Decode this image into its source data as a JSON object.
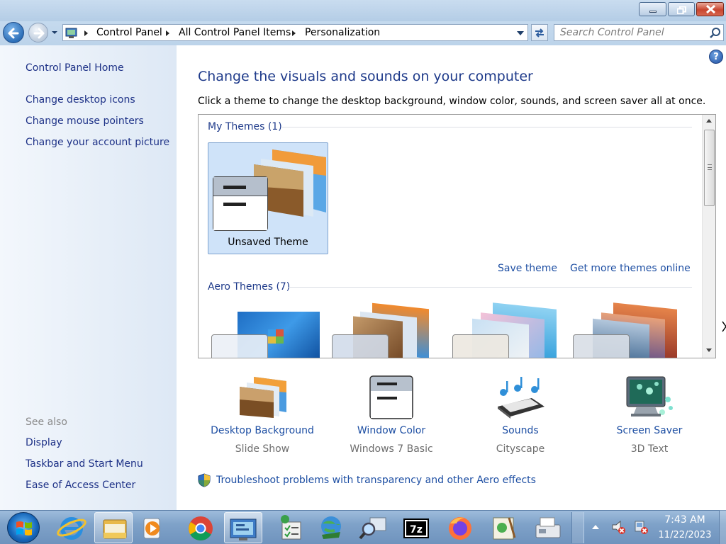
{
  "window": {
    "minimize_icon": "minimize-icon",
    "maximize_icon": "restore-icon",
    "close_icon": "close-icon"
  },
  "address": {
    "crumbs": [
      "Control Panel",
      "All Control Panel Items",
      "Personalization"
    ],
    "search_placeholder": "Search Control Panel"
  },
  "sidebar": {
    "home": "Control Panel Home",
    "links": [
      "Change desktop icons",
      "Change mouse pointers",
      "Change your account picture"
    ],
    "see_also_label": "See also",
    "see_also": [
      "Display",
      "Taskbar and Start Menu",
      "Ease of Access Center"
    ]
  },
  "main": {
    "title": "Change the visuals and sounds on your computer",
    "description": "Click a theme to change the desktop background, window color, sounds, and screen saver all at once.",
    "groups": {
      "my_themes": "My Themes (1)",
      "aero_themes": "Aero Themes (7)"
    },
    "selected_theme": "Unsaved Theme",
    "save_theme": "Save theme",
    "get_more": "Get more themes online",
    "bottom": [
      {
        "link": "Desktop Background",
        "sub": "Slide Show"
      },
      {
        "link": "Window Color",
        "sub": "Windows 7 Basic"
      },
      {
        "link": "Sounds",
        "sub": "Cityscape"
      },
      {
        "link": "Screen Saver",
        "sub": "3D Text"
      }
    ],
    "troubleshoot": "Troubleshoot problems with transparency and other Aero effects"
  },
  "taskbar": {
    "apps": [
      "internet-explorer",
      "windows-explorer",
      "media-player",
      "chrome",
      "control-panel",
      "task-manager",
      "software-updater",
      "network-search",
      "7zip",
      "firefox",
      "notepad-editor",
      "fax-scan"
    ],
    "time": "7:43 AM",
    "date": "11/22/2023"
  },
  "colors": {
    "link": "#1e4fa3",
    "title": "#1e3a8a",
    "selection": "#cfe3f9"
  }
}
